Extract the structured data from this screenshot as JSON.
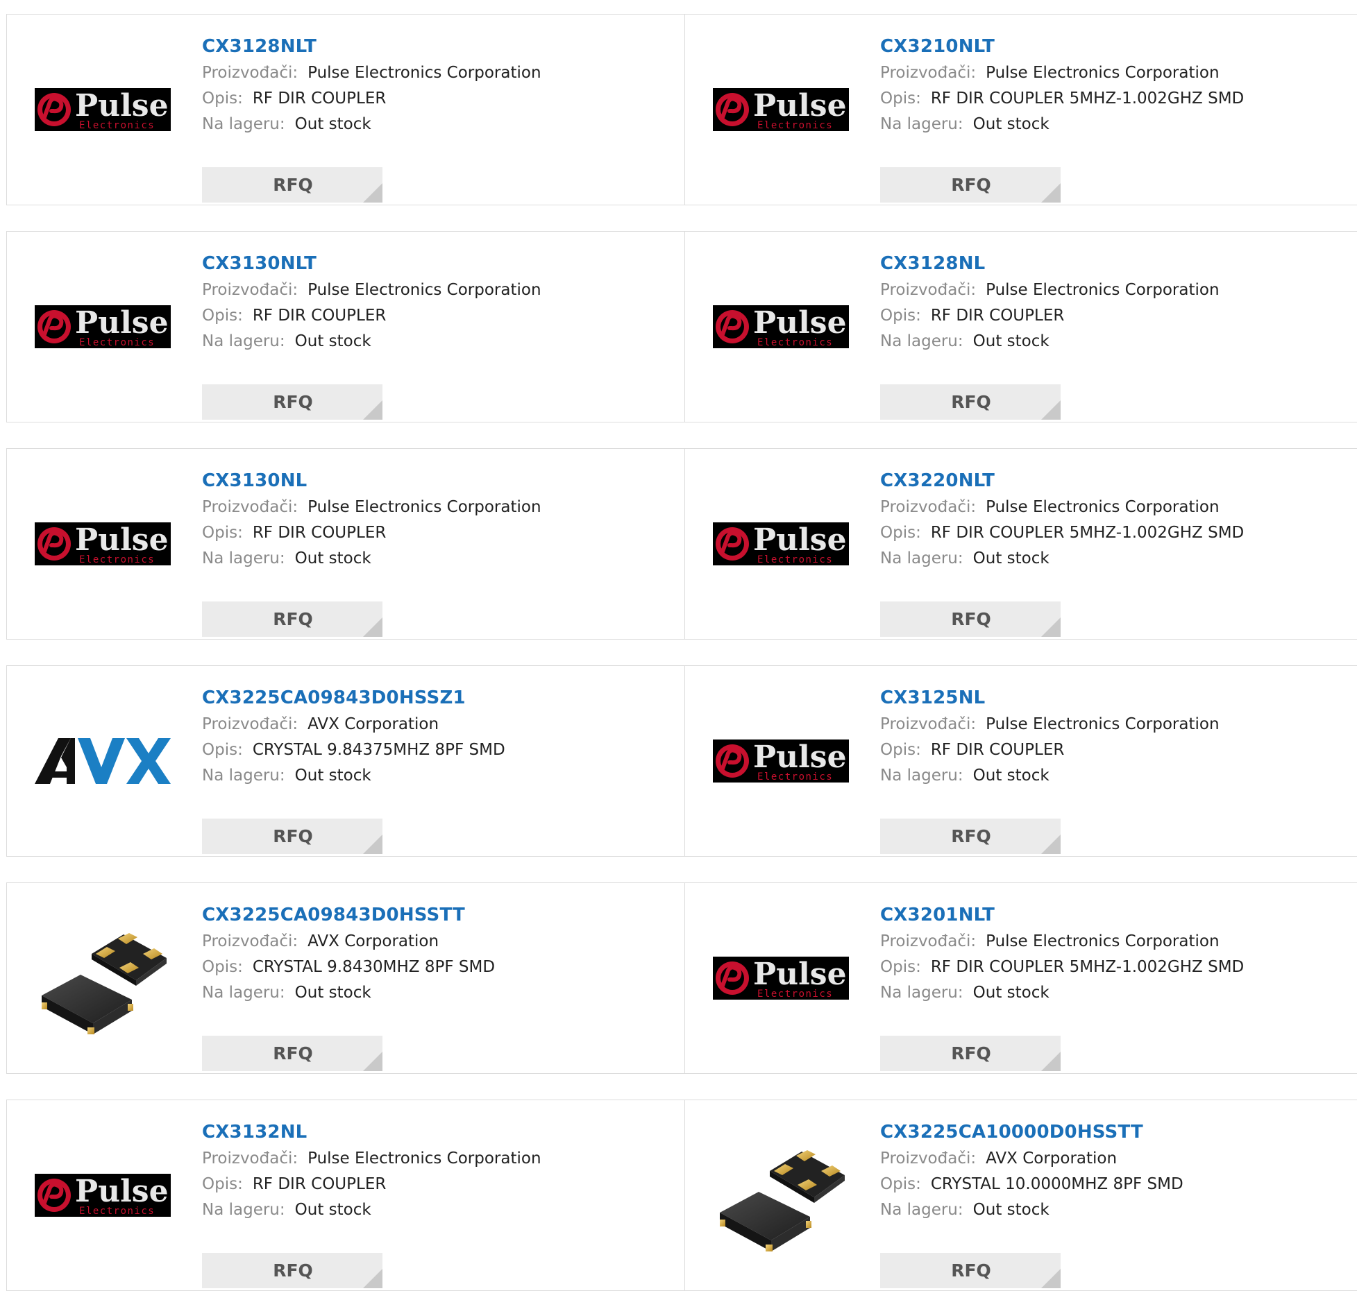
{
  "labels": {
    "manufacturer": "Proizvođači:",
    "description": "Opis:",
    "stock": "Na lageru:",
    "rfq": "RFQ"
  },
  "logos": {
    "pulse_text": "Pulse",
    "pulse_sub": "Electronics",
    "avx_text": "AVX"
  },
  "colors": {
    "part_link": "#1a6fb8",
    "avx_blue": "#1b7fc4",
    "pulse_red": "#c8102e"
  },
  "products": [
    {
      "part": "CX3128NLT",
      "manufacturer": "Pulse Electronics Corporation",
      "description": "RF DIR COUPLER",
      "stock": "Out stock",
      "image": "pulse-logo"
    },
    {
      "part": "CX3210NLT",
      "manufacturer": "Pulse Electronics Corporation",
      "description": "RF DIR COUPLER 5MHZ-1.002GHZ SMD",
      "stock": "Out stock",
      "image": "pulse-logo"
    },
    {
      "part": "CX3130NLT",
      "manufacturer": "Pulse Electronics Corporation",
      "description": "RF DIR COUPLER",
      "stock": "Out stock",
      "image": "pulse-logo"
    },
    {
      "part": "CX3128NL",
      "manufacturer": "Pulse Electronics Corporation",
      "description": "RF DIR COUPLER",
      "stock": "Out stock",
      "image": "pulse-logo"
    },
    {
      "part": "CX3130NL",
      "manufacturer": "Pulse Electronics Corporation",
      "description": "RF DIR COUPLER",
      "stock": "Out stock",
      "image": "pulse-logo"
    },
    {
      "part": "CX3220NLT",
      "manufacturer": "Pulse Electronics Corporation",
      "description": "RF DIR COUPLER 5MHZ-1.002GHZ SMD",
      "stock": "Out stock",
      "image": "pulse-logo"
    },
    {
      "part": "CX3225CA09843D0HSSZ1",
      "manufacturer": "AVX Corporation",
      "description": "CRYSTAL 9.84375MHZ 8PF SMD",
      "stock": "Out stock",
      "image": "avx-logo"
    },
    {
      "part": "CX3125NL",
      "manufacturer": "Pulse Electronics Corporation",
      "description": "RF DIR COUPLER",
      "stock": "Out stock",
      "image": "pulse-logo"
    },
    {
      "part": "CX3225CA09843D0HSSTT",
      "manufacturer": "AVX Corporation",
      "description": "CRYSTAL 9.8430MHZ 8PF SMD",
      "stock": "Out stock",
      "image": "crystal-photo"
    },
    {
      "part": "CX3201NLT",
      "manufacturer": "Pulse Electronics Corporation",
      "description": "RF DIR COUPLER 5MHZ-1.002GHZ SMD",
      "stock": "Out stock",
      "image": "pulse-logo"
    },
    {
      "part": "CX3132NL",
      "manufacturer": "Pulse Electronics Corporation",
      "description": "RF DIR COUPLER",
      "stock": "Out stock",
      "image": "pulse-logo"
    },
    {
      "part": "CX3225CA10000D0HSSTT",
      "manufacturer": "AVX Corporation",
      "description": "CRYSTAL 10.0000MHZ 8PF SMD",
      "stock": "Out stock",
      "image": "crystal-photo"
    }
  ]
}
